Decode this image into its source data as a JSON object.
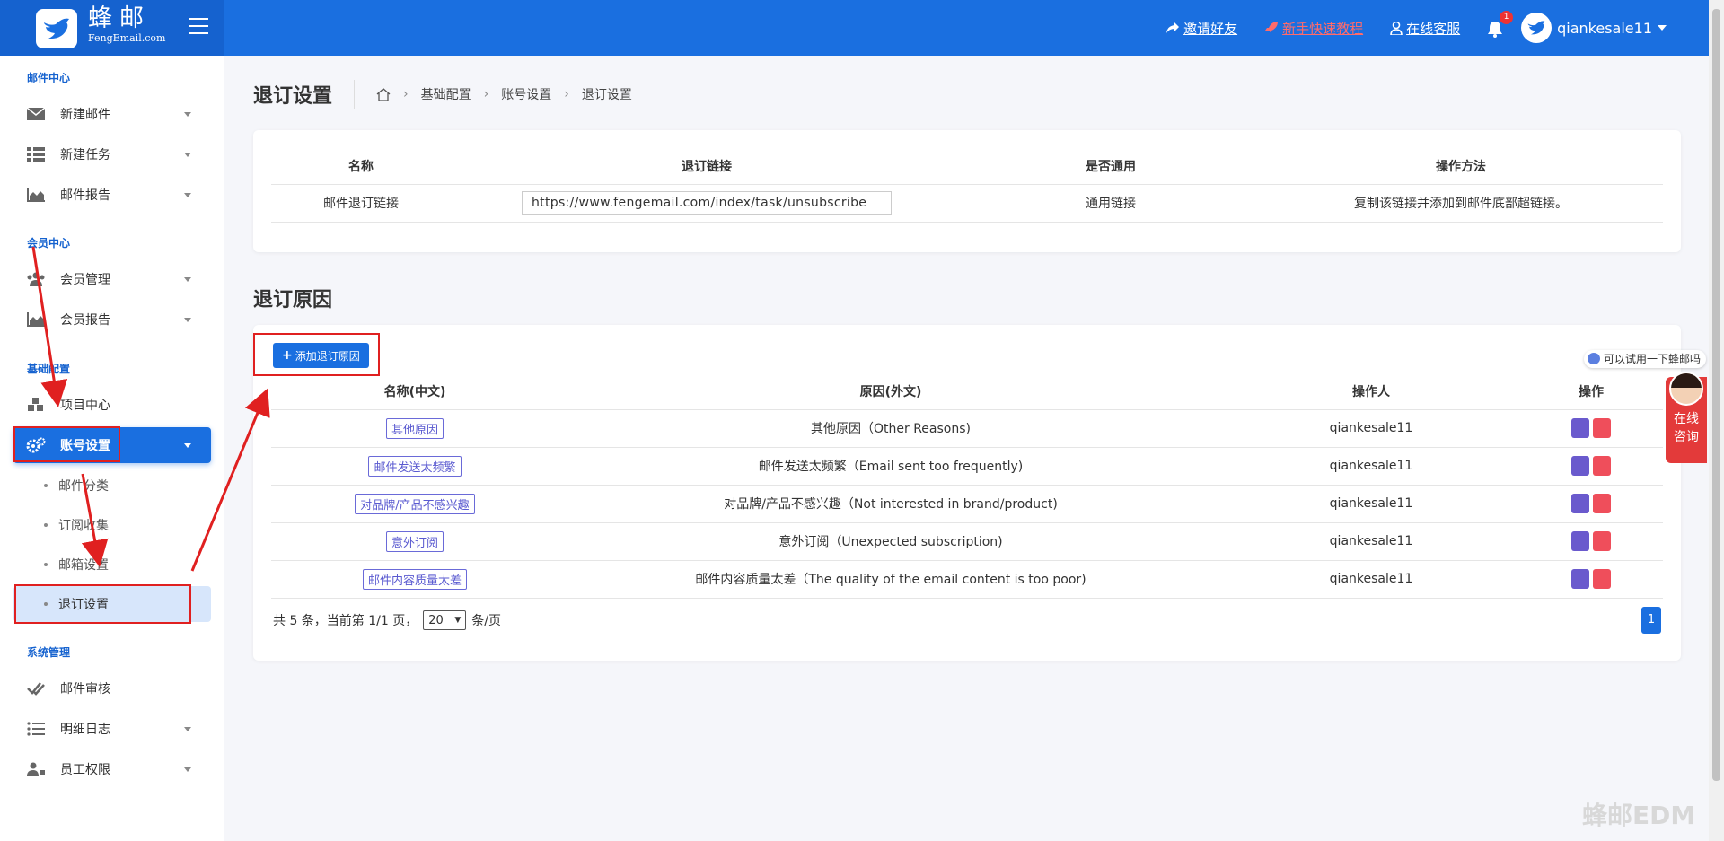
{
  "brand": {
    "name_cn": "蜂邮",
    "name_en": "FengEmail.com"
  },
  "topbar": {
    "invite": "邀请好友",
    "tutorial": "新手快速教程",
    "service": "在线客服",
    "notification_count": "1",
    "username": "qiankesale11"
  },
  "sidebar": {
    "sec_mail": "邮件中心",
    "new_mail": "新建邮件",
    "new_task": "新建任务",
    "mail_report": "邮件报告",
    "sec_member": "会员中心",
    "member_mgmt": "会员管理",
    "member_report": "会员报告",
    "sec_basic": "基础配置",
    "project_center": "项目中心",
    "account_settings": "账号设置",
    "sub_category": "邮件分类",
    "sub_subscribe": "订阅收集",
    "sub_mailbox": "邮箱设置",
    "sub_unsub": "退订设置",
    "sec_system": "系统管理",
    "mail_review": "邮件审核",
    "detail_log": "明细日志",
    "staff_perm": "员工权限"
  },
  "page": {
    "title": "退订设置",
    "breadcrumb": [
      "基础配置",
      "账号设置",
      "退订设置"
    ]
  },
  "link_table": {
    "headers": [
      "名称",
      "退订链接",
      "是否通用",
      "操作方法"
    ],
    "row": {
      "name": "邮件退订链接",
      "link": "https://www.fengemail.com/index/task/unsubscribe",
      "common": "通用链接",
      "method": "复制该链接并添加到邮件底部超链接。"
    }
  },
  "reasons": {
    "section_title": "退订原因",
    "add_button": "添加退订原因",
    "headers": [
      "名称(中文)",
      "原因(外文)",
      "操作人",
      "操作"
    ],
    "rows": [
      {
        "name": "其他原因",
        "reason": "其他原因（Other Reasons)",
        "operator": "qiankesale11"
      },
      {
        "name": "邮件发送太频繁",
        "reason": "邮件发送太频繁（Email sent too frequently)",
        "operator": "qiankesale11"
      },
      {
        "name": "对品牌/产品不感兴趣",
        "reason": "对品牌/产品不感兴趣（Not interested in brand/product)",
        "operator": "qiankesale11"
      },
      {
        "name": "意外订阅",
        "reason": "意外订阅（Unexpected subscription)",
        "operator": "qiankesale11"
      },
      {
        "name": "邮件内容质量太差",
        "reason": "邮件内容质量太差（The quality of the email content is too poor)",
        "operator": "qiankesale11"
      }
    ],
    "pager_prefix": "共 5 条，当前第 1/1 页，",
    "page_size": "20",
    "pager_suffix": "条/页",
    "current_page": "1"
  },
  "chat": {
    "tip": "可以试用一下蜂邮吗",
    "label_1": "在线",
    "label_2": "咨询"
  },
  "watermark": "蜂邮EDM"
}
